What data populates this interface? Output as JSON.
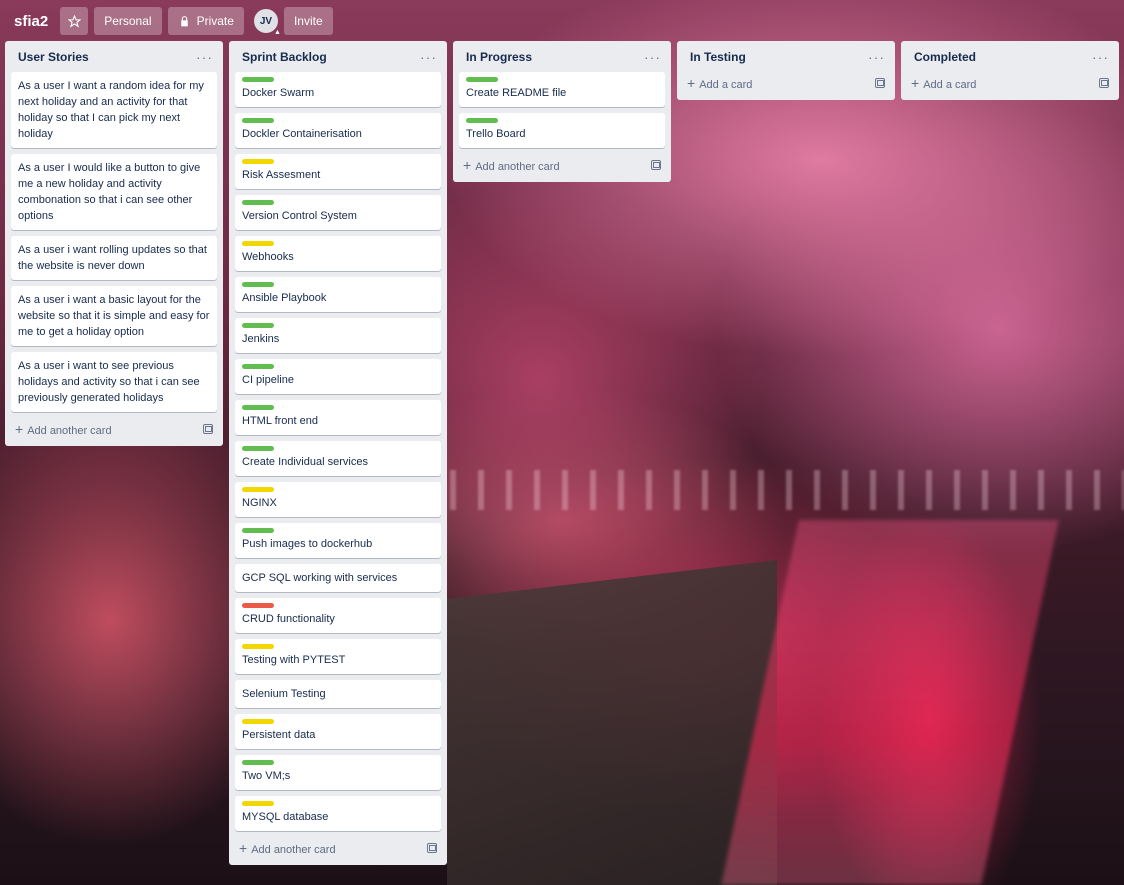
{
  "header": {
    "board_title": "sfia2",
    "star_icon": "star-icon",
    "workspace_label": "Personal",
    "visibility_label": "Private",
    "lock_icon": "lock-icon",
    "avatar_initials": "JV",
    "invite_label": "Invite"
  },
  "lists": [
    {
      "title": "User Stories",
      "cards": [
        {
          "text": "As a user I want a random idea for my next holiday and an activity for that holiday so that I can pick my next holiday",
          "label": ""
        },
        {
          "text": "As a user I would like a button to give me a new holiday and activity combonation so that i can see other options",
          "label": ""
        },
        {
          "text": "As a user i want rolling updates so that the website is never down",
          "label": ""
        },
        {
          "text": "As a user i want a basic layout for the website so that it is simple and easy for me to get a holiday option",
          "label": ""
        },
        {
          "text": "As a user i want to see previous holidays and activity so that i can see previously generated holidays",
          "label": ""
        }
      ],
      "add_label": "Add another card"
    },
    {
      "title": "Sprint Backlog",
      "cards": [
        {
          "text": "Docker Swarm",
          "label": "green"
        },
        {
          "text": "Dockler Containerisation",
          "label": "green"
        },
        {
          "text": "Risk Assesment",
          "label": "yellow"
        },
        {
          "text": "Version Control System",
          "label": "green"
        },
        {
          "text": "Webhooks",
          "label": "yellow"
        },
        {
          "text": "Ansible Playbook",
          "label": "green"
        },
        {
          "text": "Jenkins",
          "label": "green"
        },
        {
          "text": "CI pipeline",
          "label": "green"
        },
        {
          "text": "HTML front end",
          "label": "green"
        },
        {
          "text": "Create Individual services",
          "label": "green"
        },
        {
          "text": "NGINX",
          "label": "yellow"
        },
        {
          "text": "Push images to dockerhub",
          "label": "green"
        },
        {
          "text": "GCP SQL working with services",
          "label": ""
        },
        {
          "text": "CRUD functionality",
          "label": "red"
        },
        {
          "text": "Testing with PYTEST",
          "label": "yellow"
        },
        {
          "text": "Selenium Testing",
          "label": ""
        },
        {
          "text": "Persistent data",
          "label": "yellow"
        },
        {
          "text": "Two VM;s",
          "label": "green"
        },
        {
          "text": "MYSQL database",
          "label": "yellow"
        }
      ],
      "add_label": "Add another card"
    },
    {
      "title": "In Progress",
      "cards": [
        {
          "text": "Create README file",
          "label": "green"
        },
        {
          "text": "Trello Board",
          "label": "green"
        }
      ],
      "add_label": "Add another card"
    },
    {
      "title": "In Testing",
      "cards": [],
      "add_label": "Add a card"
    },
    {
      "title": "Completed",
      "cards": [],
      "add_label": "Add a card"
    }
  ],
  "colors": {
    "label_green": "#61bd4f",
    "label_yellow": "#f2d600",
    "label_red": "#eb5a46",
    "list_bg": "#ebecf0"
  }
}
